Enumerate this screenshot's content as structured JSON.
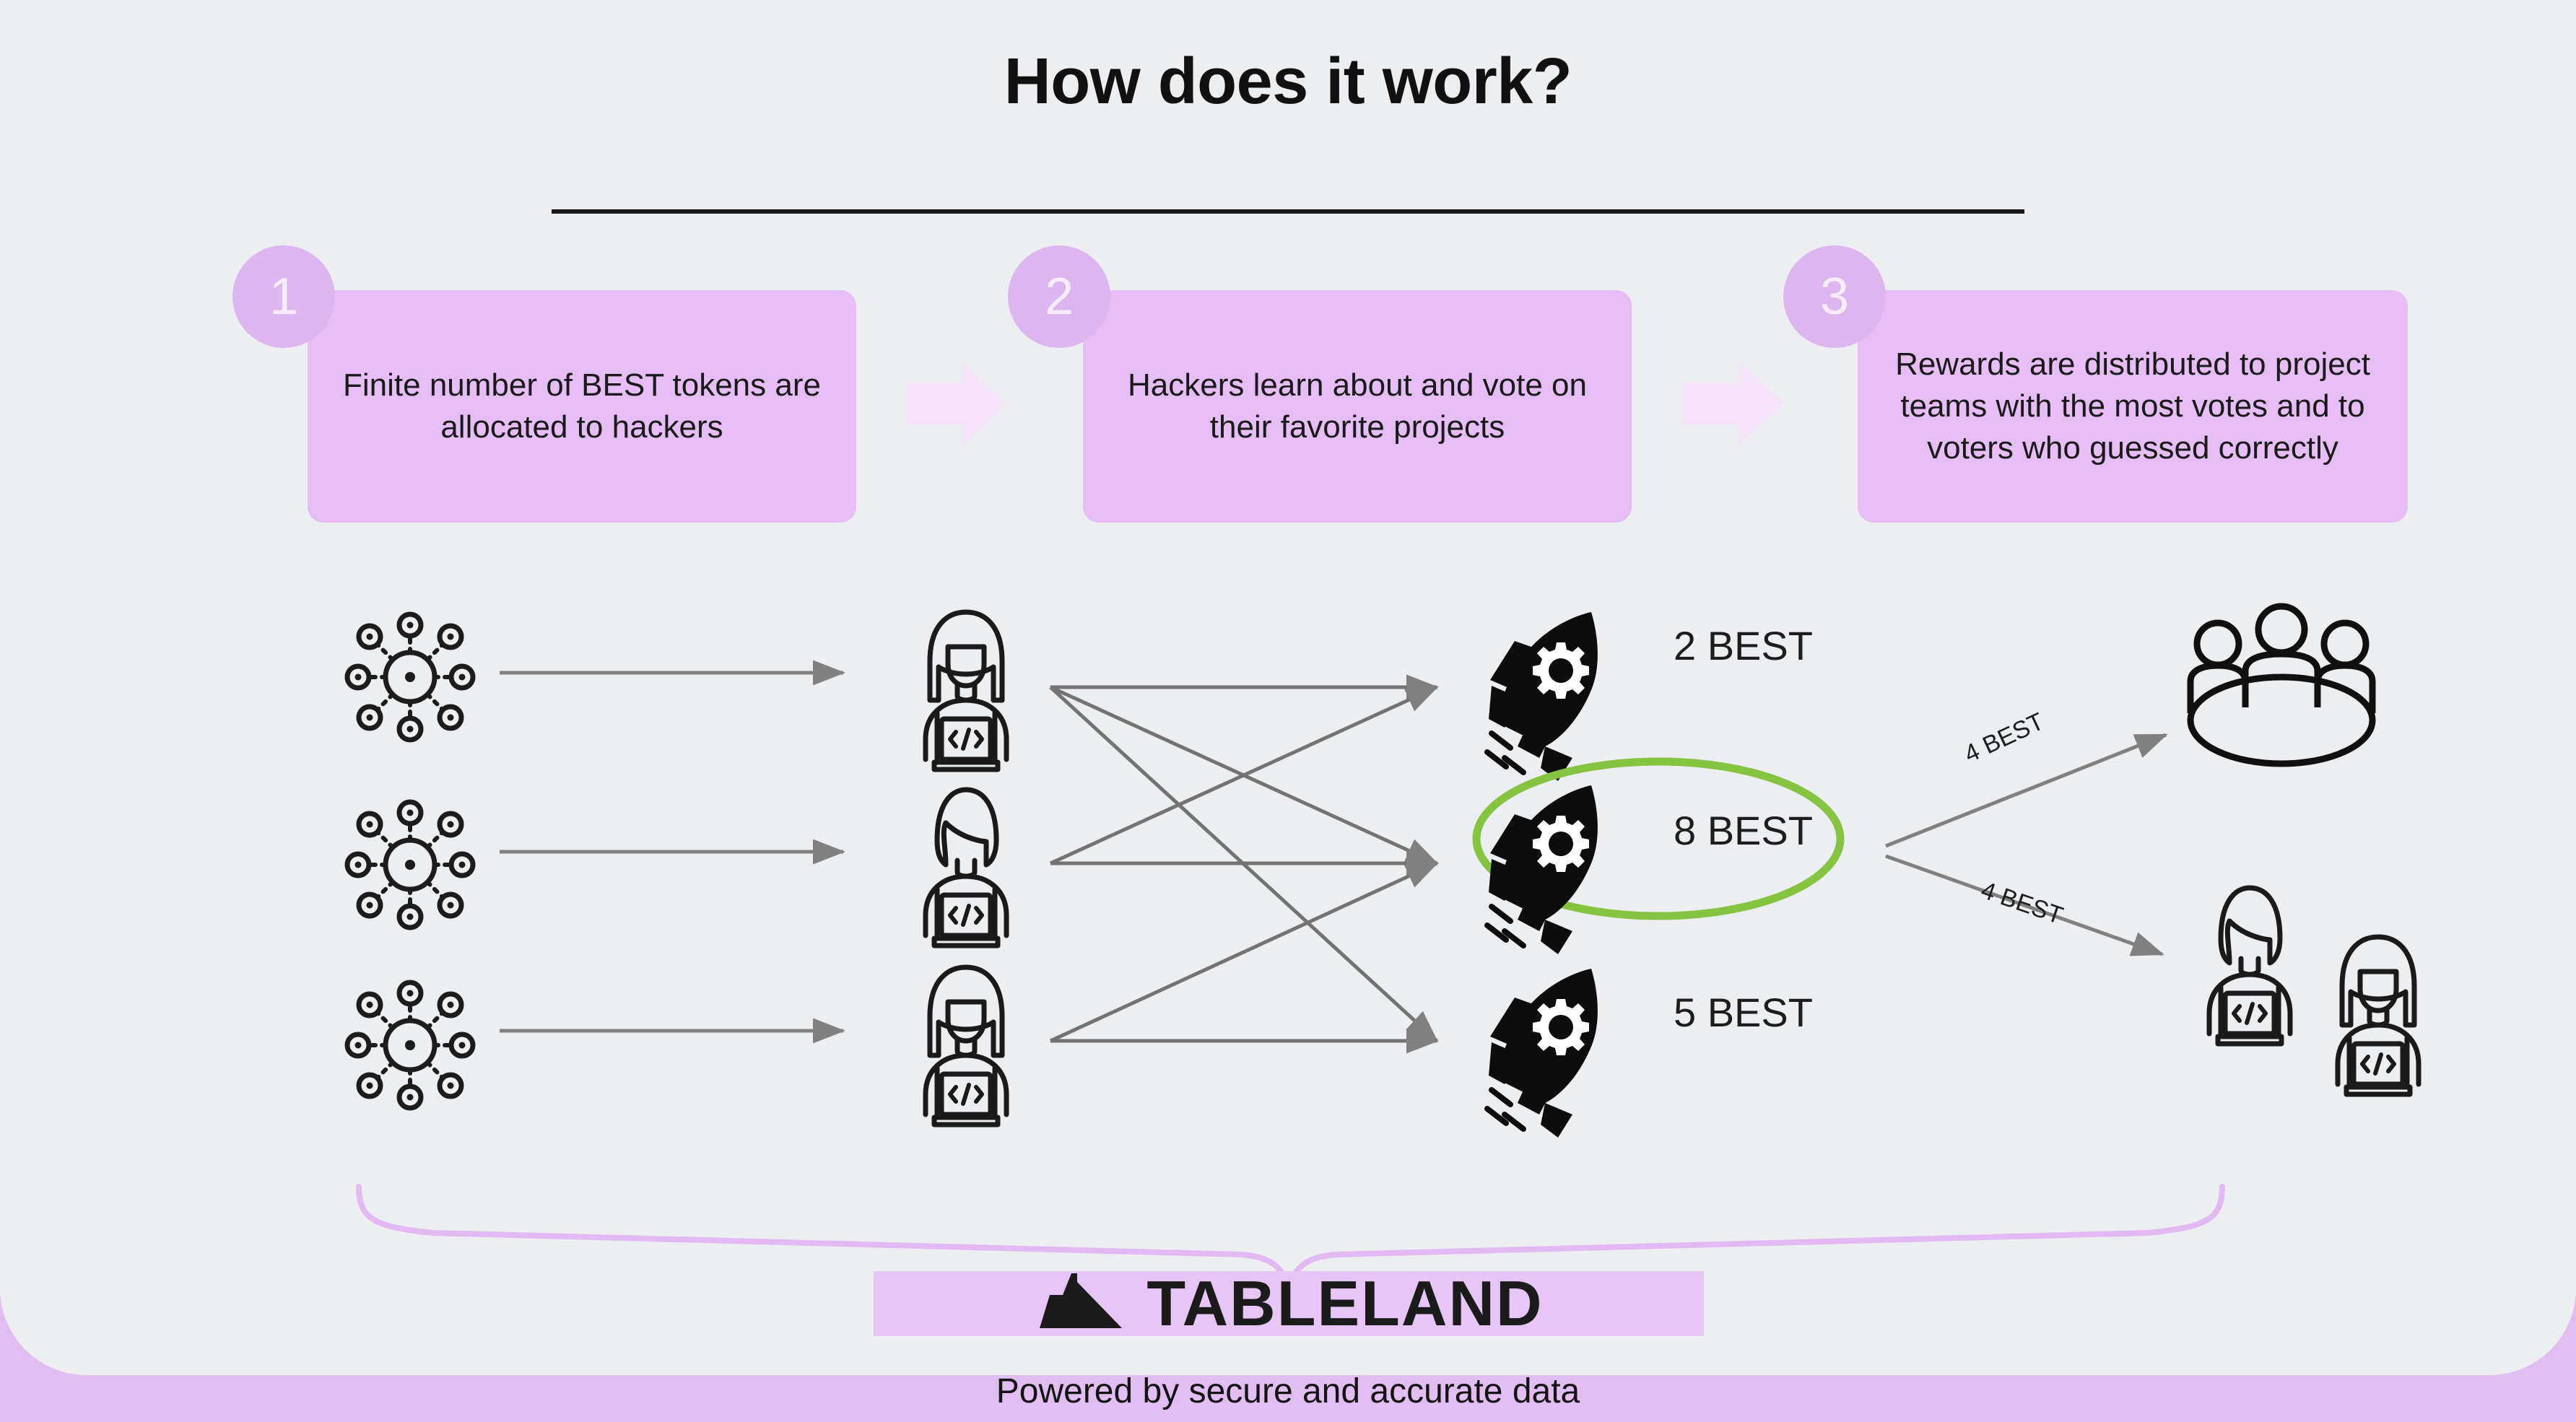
{
  "header": {
    "title": "How does it work?"
  },
  "steps": [
    {
      "number": "1",
      "text": "Finite number of BEST tokens are allocated to hackers"
    },
    {
      "number": "2",
      "text": "Hackers learn about and vote on their favorite projects"
    },
    {
      "number": "3",
      "text": "Rewards are distributed to project teams with the most votes and to voters who guessed correctly"
    }
  ],
  "diagram": {
    "token_sources": [
      {
        "name": "token-network-1"
      },
      {
        "name": "token-network-2"
      },
      {
        "name": "token-network-3"
      }
    ],
    "hackers": [
      {
        "name": "hacker-1",
        "hair": "long"
      },
      {
        "name": "hacker-2",
        "hair": "short"
      },
      {
        "name": "hacker-3",
        "hair": "long"
      }
    ],
    "projects": [
      {
        "name": "project-rocket-1",
        "label": "2 BEST",
        "votes": 2,
        "highlighted": false
      },
      {
        "name": "project-rocket-2",
        "label": "8 BEST",
        "votes": 8,
        "highlighted": true
      },
      {
        "name": "project-rocket-3",
        "label": "5 BEST",
        "votes": 5,
        "highlighted": false
      }
    ],
    "highlight_color": "#84c441",
    "rewards": [
      {
        "label": "4 BEST",
        "target": "project-team"
      },
      {
        "label": "4 BEST",
        "target": "correct-voters"
      }
    ],
    "votes": [
      {
        "from": "hacker-1",
        "to": "project-rocket-1"
      },
      {
        "from": "hacker-1",
        "to": "project-rocket-2"
      },
      {
        "from": "hacker-1",
        "to": "project-rocket-3"
      },
      {
        "from": "hacker-2",
        "to": "project-rocket-1"
      },
      {
        "from": "hacker-2",
        "to": "project-rocket-2"
      },
      {
        "from": "hacker-3",
        "to": "project-rocket-2"
      },
      {
        "from": "hacker-3",
        "to": "project-rocket-3"
      }
    ]
  },
  "footer": {
    "logo_text": "TABLELAND",
    "tagline": "Powered by secure and accurate data"
  },
  "colors": {
    "page_background": "#e2bdf2",
    "card_background": "#eceef1",
    "step_box": "#e6bdf5",
    "step_circle": "#ddb5ef",
    "chevron": "#f5e3fa",
    "arrow_gray": "#808080",
    "accent_green": "#84c441",
    "brace": "#e5bcf4"
  }
}
